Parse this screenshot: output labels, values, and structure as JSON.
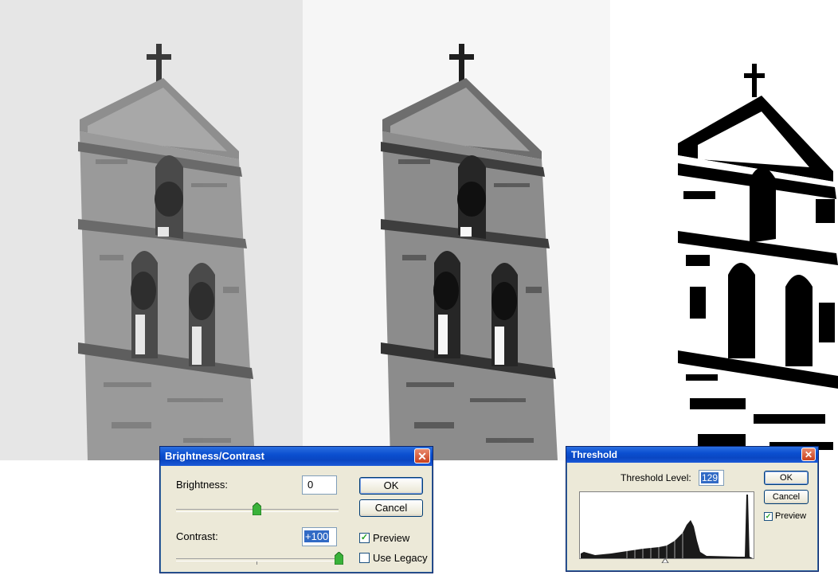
{
  "brightness_contrast": {
    "title": "Brightness/Contrast",
    "brightness_label": "Brightness:",
    "brightness_value": "0",
    "brightness_slider_fraction": 0.5,
    "contrast_label": "Contrast:",
    "contrast_value": "+100",
    "contrast_slider_fraction": 1.0,
    "ok_label": "OK",
    "cancel_label": "Cancel",
    "preview_label": "Preview",
    "preview_checked": true,
    "legacy_label": "Use Legacy",
    "legacy_checked": false
  },
  "threshold": {
    "title": "Threshold",
    "level_label": "Threshold Level:",
    "level_value": "129",
    "ok_label": "OK",
    "cancel_label": "Cancel",
    "preview_label": "Preview",
    "preview_checked": true
  },
  "icons": {
    "close": "close-icon",
    "check": "checkmark-icon",
    "slider_thumb": "slider-thumb-icon",
    "histogram_marker": "triangle-marker-icon"
  },
  "colors": {
    "titlebar": "#0b4fd0",
    "dialog_bg": "#ece9d8",
    "close_button": "#c9401d",
    "selection": "#316ac5"
  }
}
